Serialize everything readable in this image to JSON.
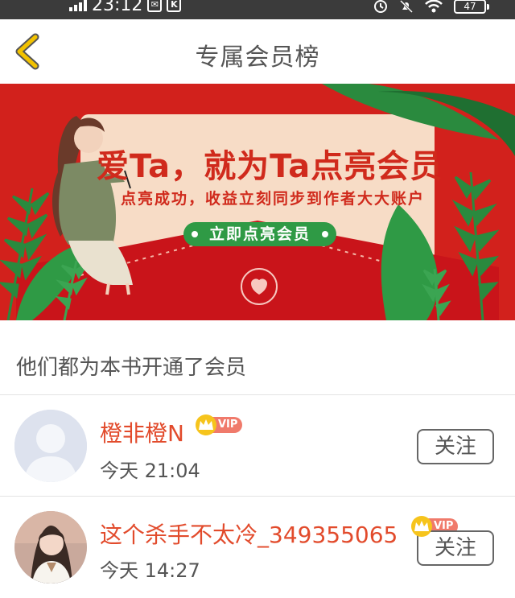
{
  "status_bar": {
    "time": "23:12",
    "battery": "47"
  },
  "nav": {
    "title": "专属会员榜"
  },
  "banner": {
    "title": "爱Ta，就为Ta点亮会员",
    "subtitle": "点亮成功，收益立刻同步到作者大大账户",
    "button_label": "立即点亮会员"
  },
  "section": {
    "title": "他们都为本书开通了会员"
  },
  "members": [
    {
      "name": "橙非橙N",
      "badge": "VIP",
      "time": "今天 21:04",
      "follow_label": "关注"
    },
    {
      "name": "这个杀手不太冷_349355065",
      "badge": "VIP",
      "time": "今天 14:27",
      "follow_label": "关注"
    }
  ],
  "colors": {
    "accent_red": "#d2211c",
    "name_orange": "#e24b2c",
    "button_green": "#2f9a45",
    "back_arrow": "#f2c200"
  }
}
